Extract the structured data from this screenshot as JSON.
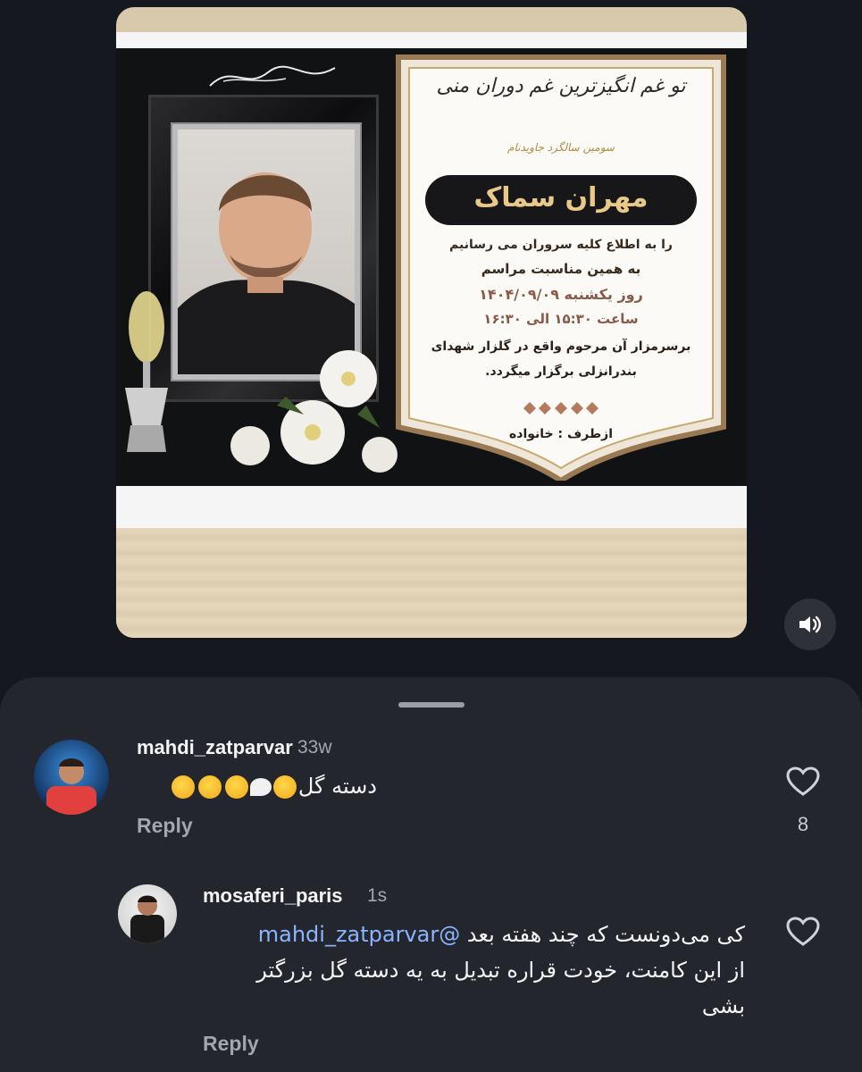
{
  "post": {
    "notice": {
      "top_calligraphy": "تو غم انگیزترین غم دوران منی",
      "subtitle": "سومین سالگرد جاویدنام",
      "name": "مهران سماک",
      "line1": "را به اطلاع کلیه سروران می رسانیم",
      "line2": "به همین مناسبت مراسم",
      "line3": "روز یکشنبه ۱۴۰۴/۰۹/۰۹",
      "line4": "ساعت ۱۵:۳۰ الی ۱۶:۳۰",
      "line5": "برسرمزار آن مرحوم واقع در گلزار شهدای",
      "line6": "بندرانزلی برگزار میگردد.",
      "line7": "ازطرف : خانواده"
    },
    "sound_icon": "speaker-icon"
  },
  "comments": [
    {
      "username": "mahdi_zatparvar",
      "time": "33w",
      "text": "دسته گل",
      "emoji_trail": "😢🕊😔😔😔",
      "reply_label": "Reply",
      "likes": "8",
      "icon": "heart-icon"
    },
    {
      "username": "mosaferi_paris",
      "time": "1s",
      "mention": "@mahdi_zatparvar",
      "text_line1": "کی می‌دونست که چند هفته بعد",
      "text_line2": "از این کامنت، خودت قراره تبدیل به یه دسته گل بزرگتر",
      "text_line3": "بشی",
      "reply_label": "Reply",
      "icon": "heart-icon"
    }
  ],
  "colors": {
    "background": "#16181f",
    "sheet": "#24262d",
    "muted_text": "#a3a6ae",
    "mention": "#8ab4ff",
    "gold": "#e8c987"
  }
}
